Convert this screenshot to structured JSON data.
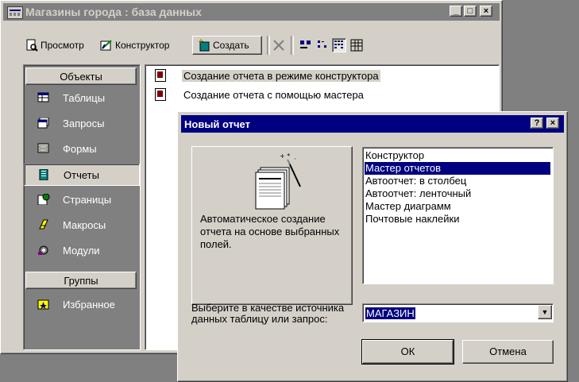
{
  "db_window": {
    "title": "Магазины города : база данных",
    "caption_buttons": [
      "_",
      "□",
      "×"
    ]
  },
  "toolbar": {
    "view_label": "Просмотр",
    "design_label": "Конструктор",
    "create_label": "Создать"
  },
  "objects_panel": {
    "objects_header": "Объекты",
    "items": [
      {
        "label": "Таблицы",
        "icon": "table-icon"
      },
      {
        "label": "Запросы",
        "icon": "query-icon"
      },
      {
        "label": "Формы",
        "icon": "form-icon"
      },
      {
        "label": "Отчеты",
        "icon": "report-icon"
      },
      {
        "label": "Страницы",
        "icon": "page-icon"
      },
      {
        "label": "Макросы",
        "icon": "macro-icon"
      },
      {
        "label": "Модули",
        "icon": "module-icon"
      }
    ],
    "groups_header": "Группы",
    "group_items": [
      {
        "label": "Избранное",
        "icon": "favorites-icon"
      }
    ]
  },
  "list": {
    "items": [
      "Создание отчета в режиме конструктора",
      "Создание отчета с помощью мастера"
    ]
  },
  "dialog": {
    "title": "Новый отчет",
    "help_button": "?",
    "close_button": "×",
    "preview_description": "Автоматическое создание отчета на основе выбранных полей.",
    "wizards": [
      "Конструктор",
      "Мастер отчетов",
      "Автоотчет: в столбец",
      "Автоотчет: ленточный",
      "Мастер диаграмм",
      "Почтовые наклейки"
    ],
    "selected_wizard": "Мастер отчетов",
    "source_label": "Выберите в качестве источника данных таблицу или запрос:",
    "source_value": "МАГАЗИН",
    "ok_label": "ОК",
    "cancel_label": "Отмена"
  },
  "colors": {
    "face": "#d4d0c8",
    "active_title": "#000080",
    "inactive_title": "#808080",
    "panel": "#808080"
  }
}
